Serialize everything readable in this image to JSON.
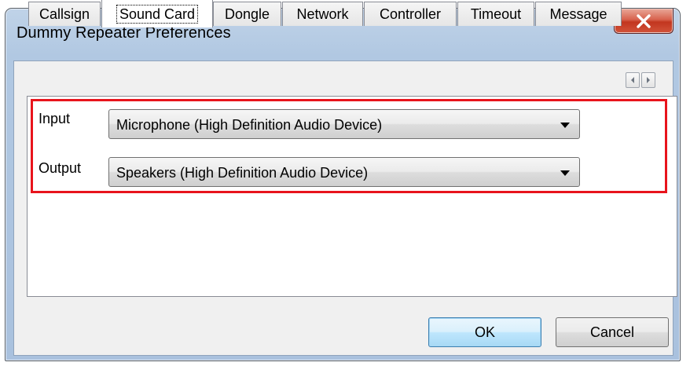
{
  "window": {
    "title": "Dummy Repeater Preferences",
    "close_glyph": "X"
  },
  "tabs": [
    {
      "label": "Callsign",
      "active": false
    },
    {
      "label": "Sound Card",
      "active": true
    },
    {
      "label": "Dongle",
      "active": false
    },
    {
      "label": "Network",
      "active": false
    },
    {
      "label": "Controller",
      "active": false
    },
    {
      "label": "Timeout",
      "active": false
    },
    {
      "label": "Message",
      "active": false
    }
  ],
  "tab_scroll": {
    "left_icon": "scroll-left-arrow",
    "right_icon": "scroll-right-arrow"
  },
  "sound_card": {
    "input_label": "Input",
    "input_value": "Microphone (High Definition Audio Device)",
    "output_label": "Output",
    "output_value": "Speakers (High Definition Audio Device)"
  },
  "buttons": {
    "ok": "OK",
    "cancel": "Cancel"
  },
  "colors": {
    "highlight_border": "#e8141c",
    "title_bar": "#b1c8e2",
    "close_button": "#c2361f",
    "default_button": "#bee6fd"
  }
}
